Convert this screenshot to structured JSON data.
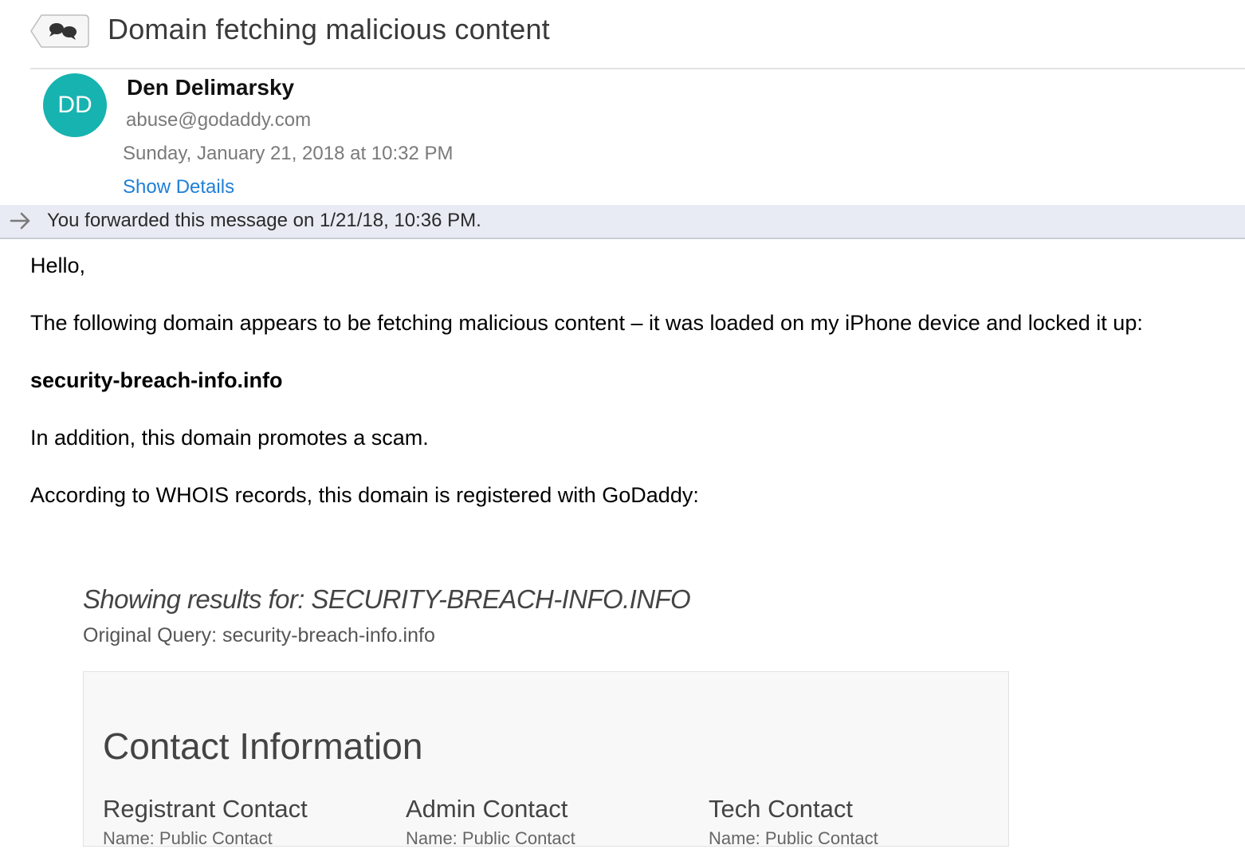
{
  "header": {
    "subject": "Domain fetching malicious content",
    "thread_icon": "speech-bubbles-icon"
  },
  "sender": {
    "initials": "DD",
    "avatar_color": "#17b3b0",
    "name": "Den Delimarsky",
    "email": "abuse@godaddy.com",
    "date": "Sunday, January 21, 2018 at 10:32 PM",
    "show_details_label": "Show Details"
  },
  "forward_banner": {
    "icon": "forward-arrow-icon",
    "text": "You forwarded this message on 1/21/18, 10:36 PM."
  },
  "body": {
    "greeting": "Hello,",
    "paragraph1": "The following domain appears to be fetching malicious content – it was loaded on my iPhone device and locked it up:",
    "domain": "security-breach-info.info",
    "paragraph2": "In addition, this domain promotes a scam.",
    "paragraph3": "According to WHOIS records, this domain is registered with GoDaddy:"
  },
  "whois": {
    "results_title": "Showing results for: SECURITY-BREACH-INFO.INFO",
    "original_query": "Original Query: security-breach-info.info",
    "contact_heading": "Contact Information",
    "columns": [
      {
        "label": "Registrant Contact",
        "partial_text": "Name: Public Contact"
      },
      {
        "label": "Admin Contact",
        "partial_text": "Name: Public Contact"
      },
      {
        "label": "Tech Contact",
        "partial_text": "Name: Public Contact"
      }
    ]
  },
  "colors": {
    "link": "#1f7fd6",
    "banner_bg": "#e8ebf3",
    "panel_bg": "#f8f8f8"
  }
}
